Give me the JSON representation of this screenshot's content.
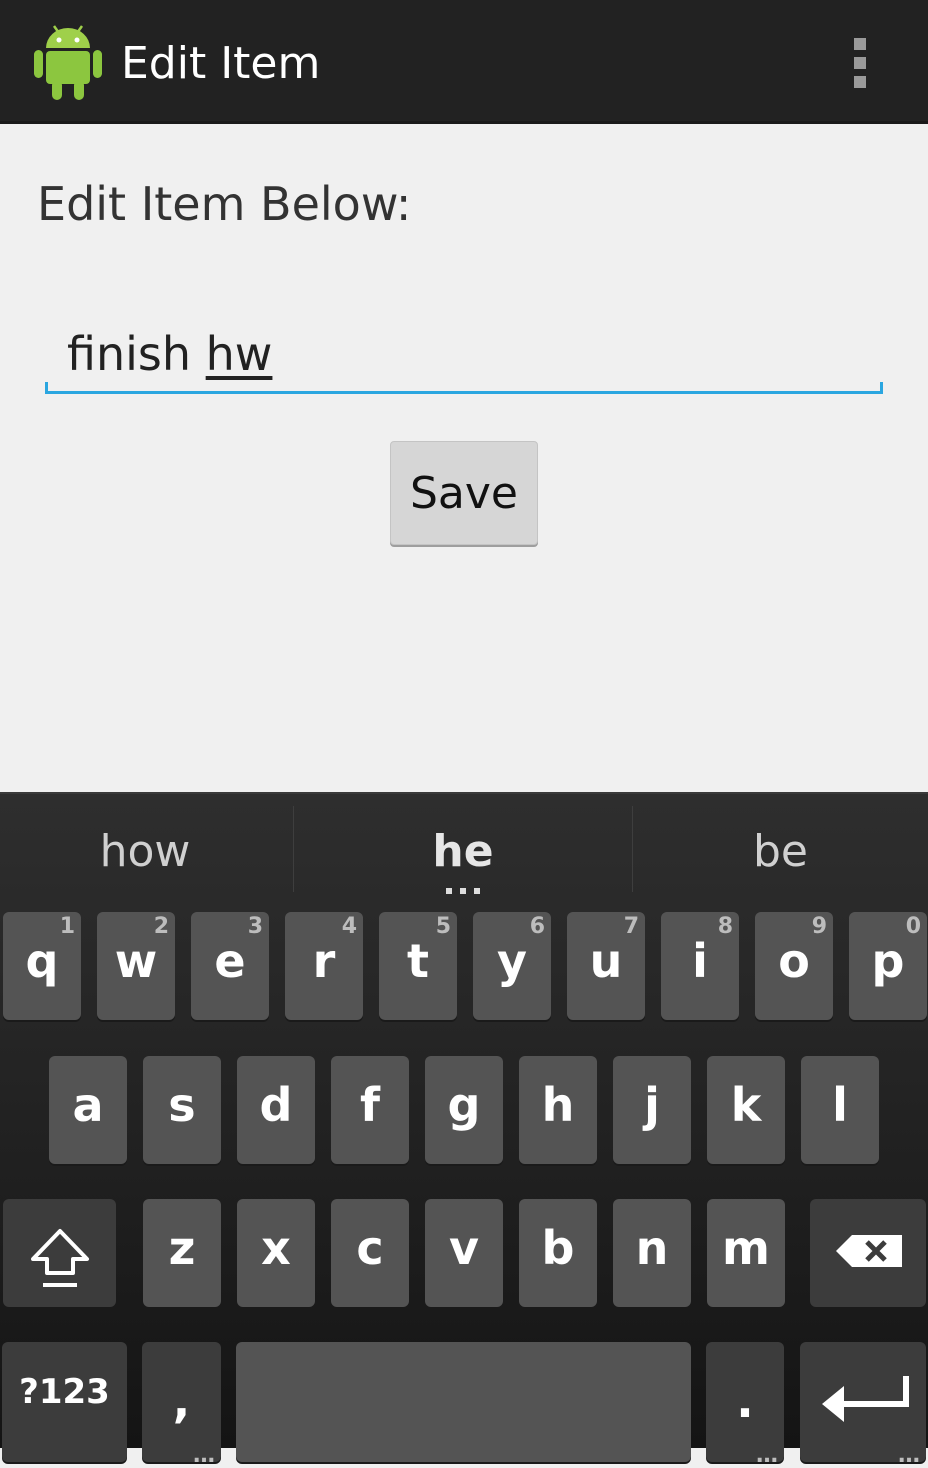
{
  "actionbar": {
    "title": "Edit Item",
    "app_icon": "android-icon",
    "overflow_icon": "overflow-menu-icon"
  },
  "form": {
    "label": "Edit Item Below:",
    "item_value_prefix": "finish ",
    "item_value_composing": "hw",
    "save_label": "Save"
  },
  "keyboard": {
    "suggestions": [
      "how",
      "he",
      "be"
    ],
    "row1": [
      {
        "ch": "q",
        "hint": "1"
      },
      {
        "ch": "w",
        "hint": "2"
      },
      {
        "ch": "e",
        "hint": "3"
      },
      {
        "ch": "r",
        "hint": "4"
      },
      {
        "ch": "t",
        "hint": "5"
      },
      {
        "ch": "y",
        "hint": "6"
      },
      {
        "ch": "u",
        "hint": "7"
      },
      {
        "ch": "i",
        "hint": "8"
      },
      {
        "ch": "o",
        "hint": "9"
      },
      {
        "ch": "p",
        "hint": "0"
      }
    ],
    "row2": [
      "a",
      "s",
      "d",
      "f",
      "g",
      "h",
      "j",
      "k",
      "l"
    ],
    "row3": [
      "z",
      "x",
      "c",
      "v",
      "b",
      "n",
      "m"
    ],
    "symbols_label": "?123",
    "comma_label": ",",
    "period_label": ".",
    "shift_icon": "shift-icon",
    "backspace_icon": "backspace-icon",
    "enter_icon": "enter-icon"
  }
}
